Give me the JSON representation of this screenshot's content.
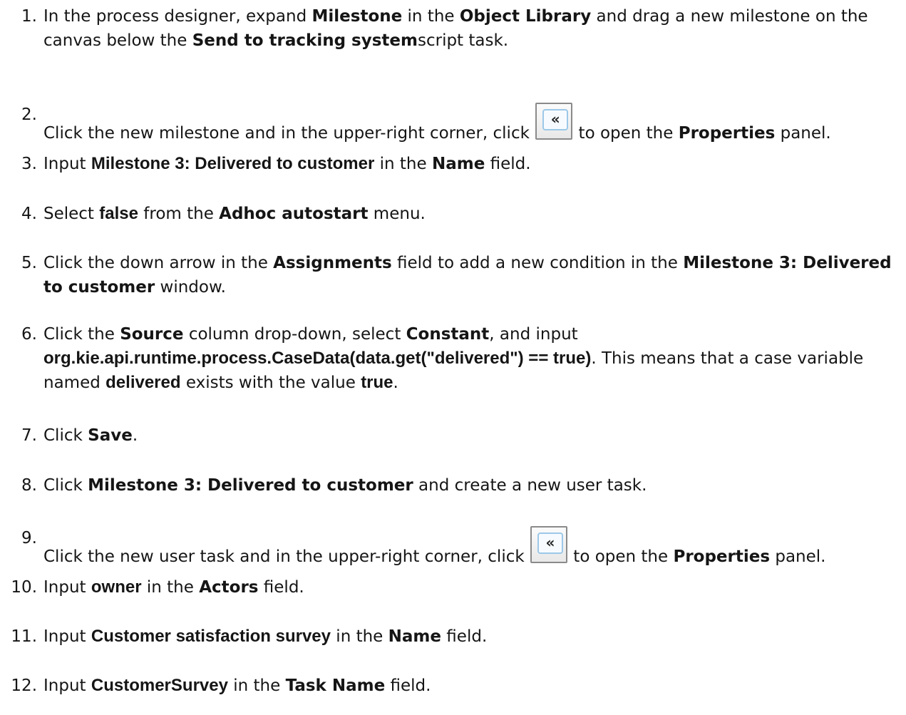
{
  "steps": [
    {
      "num": "1.",
      "parts": [
        {
          "t": "In the process designer, expand "
        },
        {
          "t": "Milestone",
          "s": "b"
        },
        {
          "t": " in the "
        },
        {
          "t": "Object Library",
          "s": "b"
        },
        {
          "t": " and drag a new milestone on the canvas below the "
        },
        {
          "t": "Send to tracking system",
          "s": "b"
        },
        {
          "t": "script task."
        }
      ]
    },
    {
      "num": "2.",
      "parts": [
        {
          "t": "Click the new milestone and in the upper-right corner, click "
        },
        {
          "icon": "collapse-panel-icon",
          "glyph": "«"
        },
        {
          "t": " to open the "
        },
        {
          "t": "Properties",
          "s": "b"
        },
        {
          "t": " panel."
        }
      ]
    },
    {
      "num": "3.",
      "parts": [
        {
          "t": "Input "
        },
        {
          "t": "Milestone 3: Delivered to customer",
          "s": "code"
        },
        {
          "t": " in the "
        },
        {
          "t": "Name",
          "s": "b"
        },
        {
          "t": " field."
        }
      ]
    },
    {
      "num": "4.",
      "parts": [
        {
          "t": "Select "
        },
        {
          "t": "false",
          "s": "code"
        },
        {
          "t": " from the "
        },
        {
          "t": "Adhoc autostart",
          "s": "b"
        },
        {
          "t": " menu."
        }
      ]
    },
    {
      "num": "5.",
      "parts": [
        {
          "t": "Click the down arrow in the "
        },
        {
          "t": "Assignments",
          "s": "b"
        },
        {
          "t": " field to add a new condition in the "
        },
        {
          "t": "Milestone 3: Delivered to customer",
          "s": "b"
        },
        {
          "t": " window."
        }
      ]
    },
    {
      "num": "6.",
      "parts": [
        {
          "t": "Click the "
        },
        {
          "t": "Source",
          "s": "b"
        },
        {
          "t": " column drop-down, select "
        },
        {
          "t": "Constant",
          "s": "b"
        },
        {
          "t": ", and input "
        },
        {
          "t": "org.kie.api.runtime.process.CaseData(data.get(\"delivered\") == true)",
          "s": "code"
        },
        {
          "t": ". This means that a case variable named "
        },
        {
          "t": "delivered",
          "s": "code"
        },
        {
          "t": " exists with the value "
        },
        {
          "t": "true",
          "s": "code"
        },
        {
          "t": "."
        }
      ]
    },
    {
      "num": "7.",
      "parts": [
        {
          "t": "Click "
        },
        {
          "t": "Save",
          "s": "b"
        },
        {
          "t": "."
        }
      ]
    },
    {
      "num": "8.",
      "parts": [
        {
          "t": "Click "
        },
        {
          "t": "Milestone 3: Delivered to customer",
          "s": "b"
        },
        {
          "t": " and create a new user task."
        }
      ]
    },
    {
      "num": "9.",
      "parts": [
        {
          "t": "Click the new user task and in the upper-right corner, click "
        },
        {
          "icon": "collapse-panel-icon",
          "glyph": "«"
        },
        {
          "t": " to open the "
        },
        {
          "t": "Properties",
          "s": "b"
        },
        {
          "t": " panel."
        }
      ]
    },
    {
      "num": "10.",
      "parts": [
        {
          "t": "Input "
        },
        {
          "t": "owner",
          "s": "code"
        },
        {
          "t": " in the "
        },
        {
          "t": "Actors",
          "s": "b"
        },
        {
          "t": " field."
        }
      ]
    },
    {
      "num": "11.",
      "parts": [
        {
          "t": "Input "
        },
        {
          "t": "Customer satisfaction survey",
          "s": "code"
        },
        {
          "t": " in the "
        },
        {
          "t": "Name",
          "s": "b"
        },
        {
          "t": " field."
        }
      ]
    },
    {
      "num": "12.",
      "parts": [
        {
          "t": "Input "
        },
        {
          "t": "CustomerSurvey",
          "s": "code"
        },
        {
          "t": " in the "
        },
        {
          "t": "Task Name",
          "s": "b"
        },
        {
          "t": " field."
        }
      ]
    }
  ]
}
